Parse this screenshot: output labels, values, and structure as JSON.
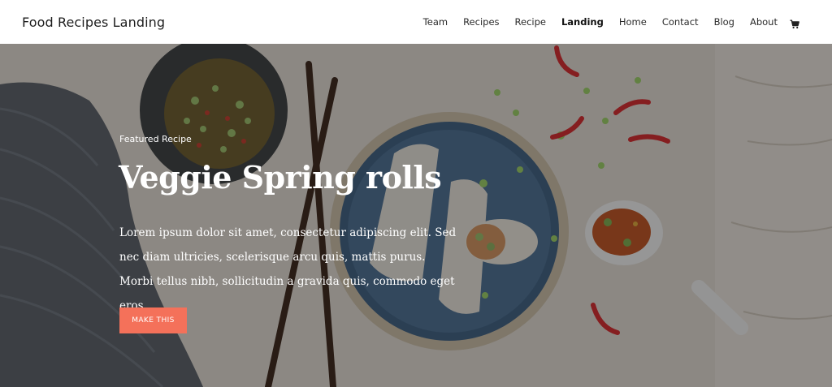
{
  "header": {
    "site_title": "Food Recipes Landing",
    "nav": [
      "Team",
      "Recipes",
      "Recipe",
      "Landing",
      "Home",
      "Contact",
      "Blog",
      "About"
    ],
    "active_item": "Landing",
    "cart_icon": "cart-icon"
  },
  "hero": {
    "eyebrow": "Featured Recipe",
    "title": "Veggie Spring rolls",
    "description": "Lorem ipsum dolor sit amet, consectetur adipiscing elit. Sed nec diam ultricies, scelerisque arcu quis, mattis purus. Morbi tellus nibh, sollicitudin a gravida quis, commodo eget eros.",
    "cta_label": "MAKE THIS",
    "colors": {
      "accent": "#f4715a",
      "plate": "#4a6e93",
      "chili": "#d8262a"
    }
  }
}
